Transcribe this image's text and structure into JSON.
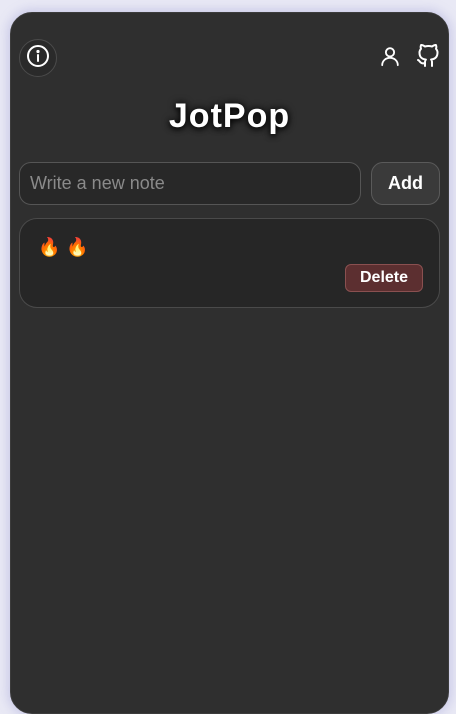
{
  "app": {
    "title": "JotPop"
  },
  "header": {
    "info_icon": "info-circle-icon",
    "user_icon": "user-icon",
    "github_icon": "github-icon"
  },
  "compose": {
    "placeholder": "Write a new note",
    "value": "",
    "add_label": "Add"
  },
  "notes": [
    {
      "text": "🔥🔥",
      "delete_label": "Delete"
    }
  ],
  "colors": {
    "background": "#2f2f2f",
    "card": "#262626",
    "delete": "#5c2f30",
    "text": "#ffffff"
  }
}
